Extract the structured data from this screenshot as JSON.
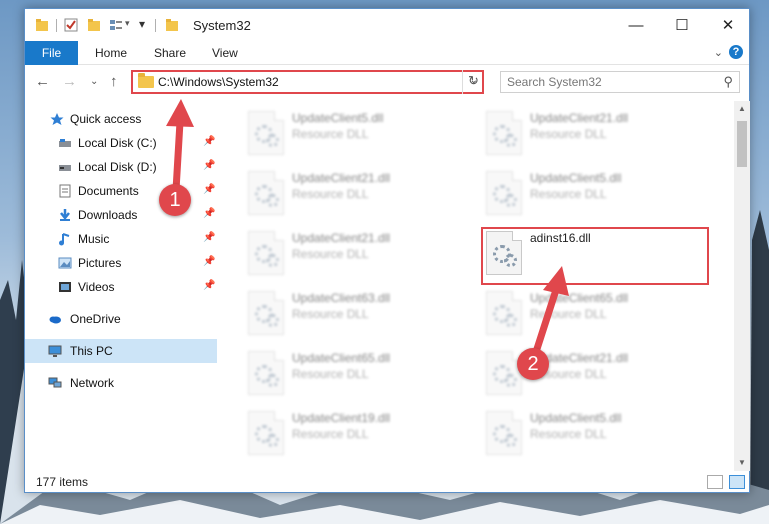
{
  "window": {
    "title": "System32",
    "controls": {
      "minimize": "—",
      "maximize": "☐",
      "close": "✕"
    }
  },
  "ribbon": {
    "file_tab": "File",
    "tabs": [
      "Home",
      "Share",
      "View"
    ],
    "help": "?"
  },
  "navbar": {
    "address_path": "C:\\Windows\\System32",
    "search_placeholder": "Search System32"
  },
  "navpane": {
    "quick_access": "Quick access",
    "items": [
      {
        "label": "Local Disk (C:)",
        "icon": "drive-icon",
        "pinned": true
      },
      {
        "label": "Local Disk (D:)",
        "icon": "drive-icon",
        "pinned": true
      },
      {
        "label": "Documents",
        "icon": "documents-icon",
        "pinned": true
      },
      {
        "label": "Downloads",
        "icon": "downloads-icon",
        "pinned": true
      },
      {
        "label": "Music",
        "icon": "music-icon",
        "pinned": true
      },
      {
        "label": "Pictures",
        "icon": "pictures-icon",
        "pinned": true
      },
      {
        "label": "Videos",
        "icon": "videos-icon",
        "pinned": true
      }
    ],
    "onedrive": "OneDrive",
    "this_pc": "This PC",
    "network": "Network"
  },
  "files": {
    "left_column": [
      {
        "name": "UpdateClient5.dll",
        "type": "Resource DLL"
      },
      {
        "name": "UpdateClient21.dll",
        "type": "Resource DLL"
      },
      {
        "name": "UpdateClient21.dll",
        "type": "Resource DLL"
      },
      {
        "name": "UpdateClient63.dll",
        "type": "Resource DLL"
      },
      {
        "name": "UpdateClient65.dll",
        "type": "Resource DLL"
      },
      {
        "name": "UpdateClient19.dll",
        "type": "Resource DLL"
      }
    ],
    "right_column": [
      {
        "name": "UpdateClient21.dll",
        "type": "Resource DLL"
      },
      {
        "name": "UpdateClient5.dll",
        "type": "Resource DLL"
      },
      {
        "name": "adinst16.dll",
        "type": ""
      },
      {
        "name": "UpdateClient65.dll",
        "type": "Resource DLL"
      },
      {
        "name": "UpdateClient21.dll",
        "type": "Resource DLL"
      },
      {
        "name": "UpdateClient5.dll",
        "type": "Resource DLL"
      }
    ]
  },
  "status": {
    "item_count": "177 items"
  },
  "annotations": {
    "step1": "1",
    "step2": "2",
    "color": "#e0474c"
  }
}
